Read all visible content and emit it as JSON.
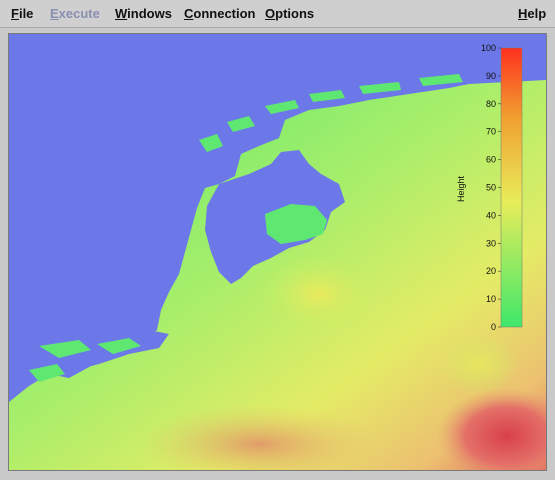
{
  "menubar": {
    "items": [
      {
        "label": "File",
        "accel": "F",
        "disabled": false
      },
      {
        "label": "Execute",
        "accel": "E",
        "disabled": true
      },
      {
        "label": "Windows",
        "accel": "W",
        "disabled": false
      },
      {
        "label": "Connection",
        "accel": "C",
        "disabled": false
      },
      {
        "label": "Options",
        "accel": "O",
        "disabled": false
      },
      {
        "label": "Help",
        "accel": "H",
        "disabled": false
      }
    ]
  },
  "colors": {
    "water": "#6c78e8",
    "low": "#3fe86a",
    "mid": "#e8ec5a",
    "high": "#e05a4a",
    "menubar": "#cfcfcf"
  },
  "legend": {
    "title": "Height",
    "ticks": [
      "100",
      "90",
      "80",
      "70",
      "60",
      "50",
      "40",
      "30",
      "20",
      "10",
      "0"
    ],
    "range": [
      0,
      100
    ],
    "gradient": [
      "#3fe86a",
      "#e8ec5a",
      "#f0a030",
      "#ff3020"
    ]
  }
}
